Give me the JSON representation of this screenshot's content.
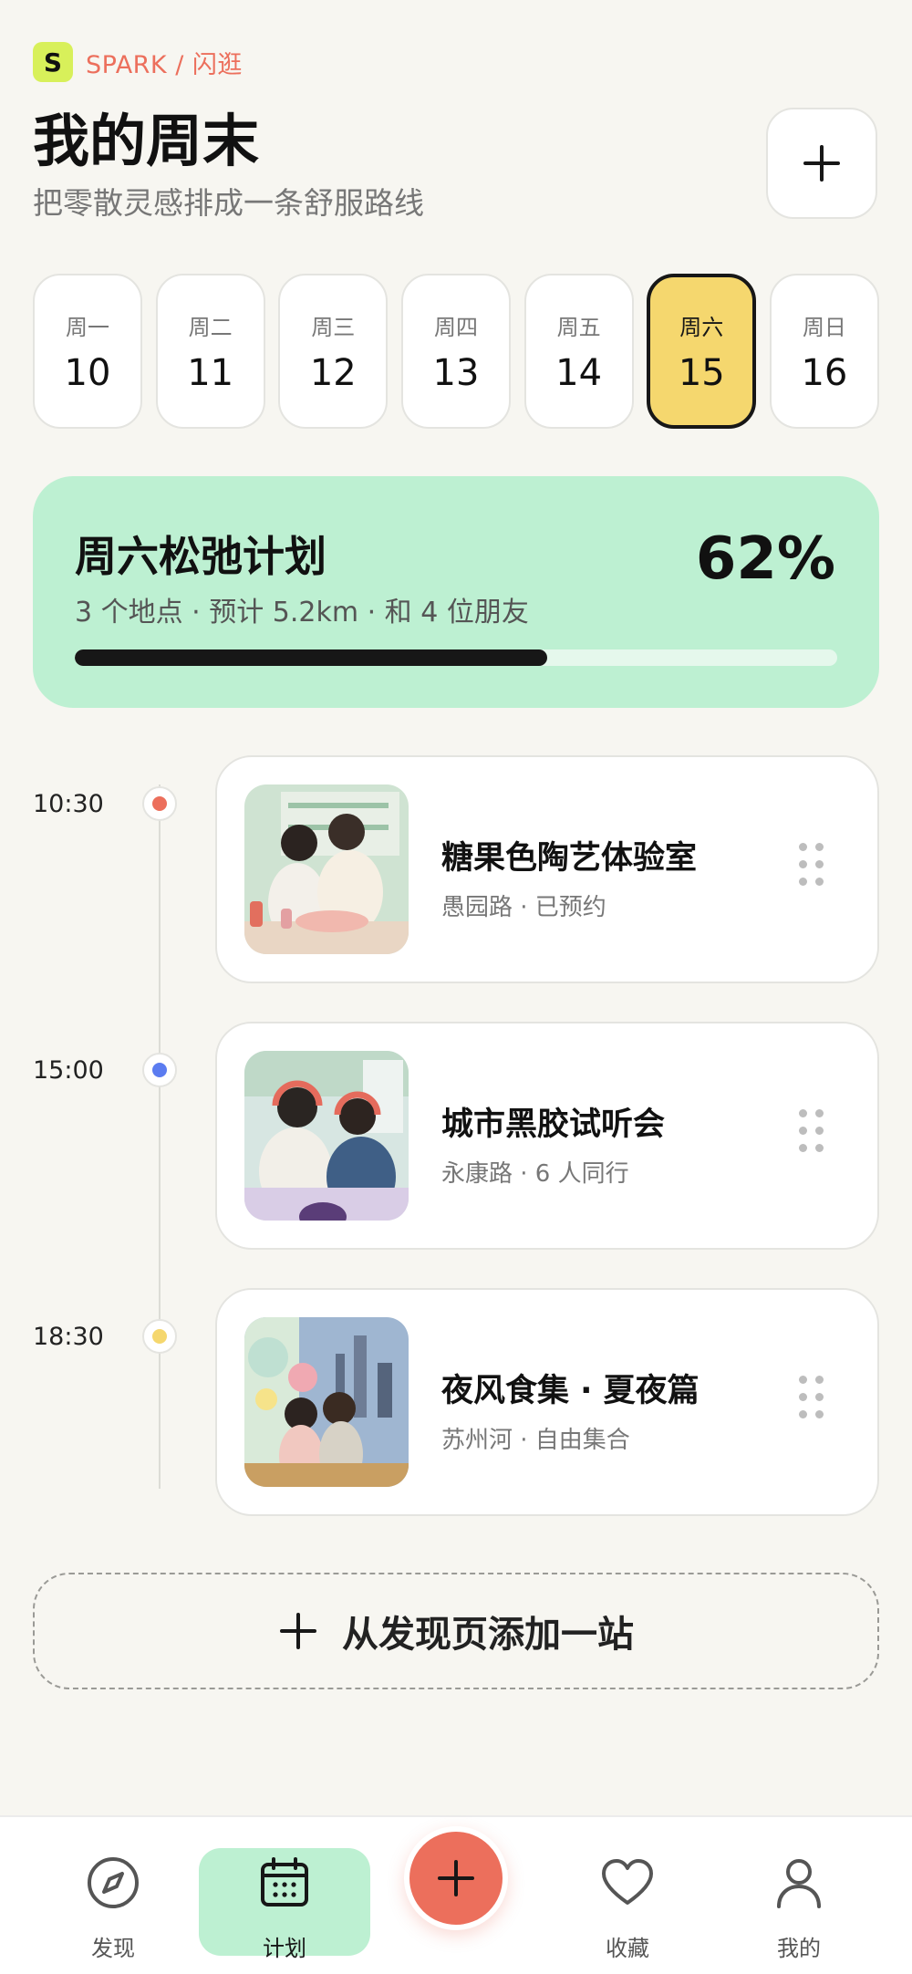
{
  "brand": {
    "logo_letter": "S",
    "name": "SPARK / 闪逛"
  },
  "header": {
    "title": "我的周末",
    "subtitle": "把零散灵感排成一条舒服路线"
  },
  "days": [
    {
      "name": "周一",
      "num": "10",
      "selected": false
    },
    {
      "name": "周二",
      "num": "11",
      "selected": false
    },
    {
      "name": "周三",
      "num": "12",
      "selected": false
    },
    {
      "name": "周四",
      "num": "13",
      "selected": false
    },
    {
      "name": "周五",
      "num": "14",
      "selected": false
    },
    {
      "name": "周六",
      "num": "15",
      "selected": true
    },
    {
      "name": "周日",
      "num": "16",
      "selected": false
    }
  ],
  "plan": {
    "title": "周六松弛计划",
    "meta": "3 个地点 · 预计 5.2km · 和 4 位朋友",
    "percent_label": "62%",
    "progress": 0.62
  },
  "stops": [
    {
      "time": "10:30",
      "dot_color": "#ec6f5c",
      "title": "糖果色陶艺体验室",
      "subtitle": "愚园路 · 已预约"
    },
    {
      "time": "15:00",
      "dot_color": "#5b7cf0",
      "title": "城市黑胶试听会",
      "subtitle": "永康路 · 6 人同行"
    },
    {
      "time": "18:30",
      "dot_color": "#f5d76e",
      "title": "夜风食集 · 夏夜篇",
      "subtitle": "苏州河 · 自由集合"
    }
  ],
  "add_stop": {
    "label": "从发现页添加一站"
  },
  "nav": {
    "items": [
      {
        "label": "发现",
        "icon": "compass-icon"
      },
      {
        "label": "计划",
        "icon": "calendar-icon",
        "active": true
      },
      {
        "label": "收藏",
        "icon": "heart-icon"
      },
      {
        "label": "我的",
        "icon": "user-icon"
      }
    ],
    "fab_icon": "plus-icon"
  },
  "colors": {
    "accent": "#ec6f5c",
    "mint": "#bdf0d2",
    "yellow": "#f5d76e",
    "blue": "#5b7cf0"
  }
}
